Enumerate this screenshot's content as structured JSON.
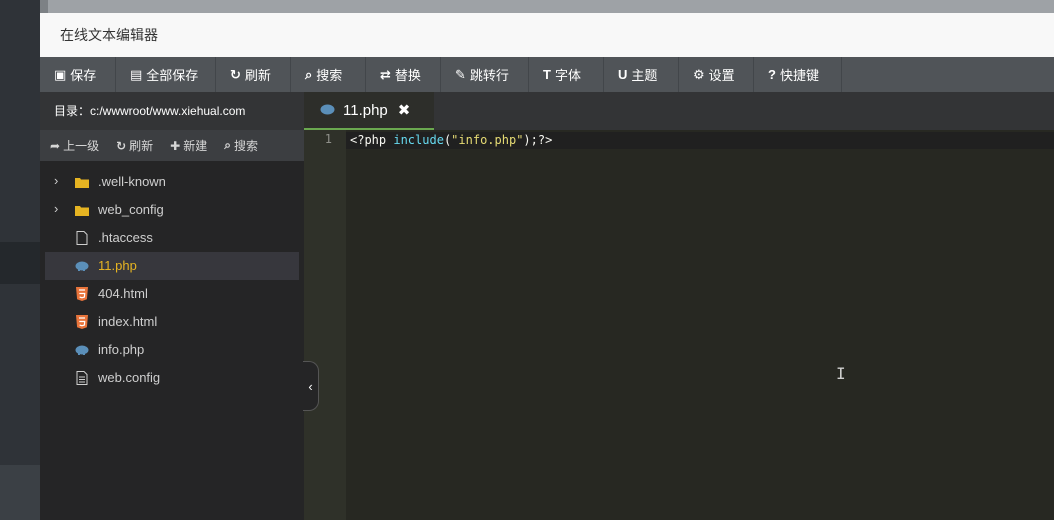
{
  "window": {
    "title": "在线文本编辑器"
  },
  "toolbar": [
    {
      "icon": "save-icon",
      "glyph": "▣",
      "label": "保存"
    },
    {
      "icon": "save-all-icon",
      "glyph": "▤",
      "label": "全部保存"
    },
    {
      "icon": "refresh-icon",
      "glyph": "↻",
      "label": "刷新"
    },
    {
      "icon": "search-icon",
      "glyph": "⌕",
      "label": "搜索"
    },
    {
      "icon": "replace-icon",
      "glyph": "⇄",
      "label": "替换"
    },
    {
      "icon": "goto-line-icon",
      "glyph": "✎",
      "label": "跳转行"
    },
    {
      "icon": "font-icon",
      "glyph": "T",
      "label": "字体"
    },
    {
      "icon": "theme-icon",
      "glyph": "U",
      "label": "主题"
    },
    {
      "icon": "gear-icon",
      "glyph": "⚙",
      "label": "设置"
    },
    {
      "icon": "help-icon",
      "glyph": "?",
      "label": "快捷键"
    }
  ],
  "sidebar": {
    "directory": "目录：c:/wwwroot/www.xiehual.com",
    "tools": [
      {
        "icon": "share-icon",
        "glyph": "➦",
        "label": "上一级"
      },
      {
        "icon": "refresh-icon",
        "glyph": "↻",
        "label": "刷新"
      },
      {
        "icon": "plus-icon",
        "glyph": "✚",
        "label": "新建"
      },
      {
        "icon": "search-icon",
        "glyph": "⌕",
        "label": "搜索"
      }
    ],
    "files": [
      {
        "name": ".well-known",
        "type": "folder",
        "expandable": true
      },
      {
        "name": "web_config",
        "type": "folder",
        "expandable": true
      },
      {
        "name": ".htaccess",
        "type": "file",
        "expandable": false
      },
      {
        "name": "11.php",
        "type": "php",
        "expandable": false,
        "active": true
      },
      {
        "name": "404.html",
        "type": "html",
        "expandable": false
      },
      {
        "name": "index.html",
        "type": "html",
        "expandable": false
      },
      {
        "name": "info.php",
        "type": "php",
        "expandable": false
      },
      {
        "name": "web.config",
        "type": "text",
        "expandable": false
      }
    ]
  },
  "editor": {
    "tab": {
      "name": "11.php",
      "close": "✖"
    },
    "line_number": "1",
    "code": {
      "part1": "<?php ",
      "keyword": "include",
      "part2": "(",
      "string": "\"info.php\"",
      "part3": ");?>"
    },
    "cursor_glyph": "I"
  },
  "collapse": "‹",
  "colors": {
    "toolbar_bg": "#505458",
    "sidebar_bg": "#252526",
    "editor_bg": "#272822",
    "folder": "#e6b422",
    "html": "#e8743b",
    "php": "#5b8fb9",
    "active_file_text": "#e6b422",
    "tab_underline": "#6aa84f"
  }
}
